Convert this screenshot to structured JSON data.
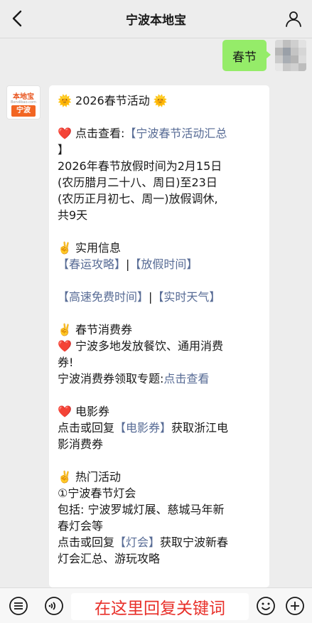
{
  "header": {
    "title": "宁波本地宝"
  },
  "outgoing": {
    "text": "春节"
  },
  "bot": {
    "logo_text": "本地宝",
    "logo_url": "Bendibao.com",
    "logo_city": "宁波"
  },
  "message": {
    "title": "2026春节活动",
    "l1_prefix": "点击查看:",
    "l1_link": "【宁波春节活动汇总",
    "l1_tail": "】",
    "l2": "2026年春节放假时间为2月15日",
    "l3": "(农历腊月二十八、周日)至23日",
    "l4": "(农历正月初七、周一)放假调休,",
    "l5": "共9天",
    "s1_title": "实用信息",
    "s1_link1": "【春运攻略】",
    "s1_sep1": "|",
    "s1_link2": "【放假时间】",
    "s1_link3": "【高速免费时间】",
    "s1_sep2": "|",
    "s1_link4": "【实时天气】",
    "s2_title": "春节消费券",
    "s2_l1": "宁波多地发放餐饮、通用消费",
    "s2_l2": "券!",
    "s2_l3": "宁波消费券领取专题:",
    "s2_l3_link": "点击查看",
    "s3_title": "电影券",
    "s3_l1_a": "点击或回复",
    "s3_l1_link": "【电影券】",
    "s3_l1_b": "获取浙江电",
    "s3_l2": "影消费券",
    "s4_title": "热门活动",
    "s4_l1": "①宁波春节灯会",
    "s4_l2": "包括: 宁波罗城灯展、慈城马年新",
    "s4_l3": "春灯会等",
    "s4_l4_a": "点击或回复",
    "s4_l4_link": "【灯会】",
    "s4_l4_b": "获取宁波新春",
    "s4_l5": "灯会汇总、游玩攻略"
  },
  "bottom": {
    "input_placeholder": "在这里回复关键词"
  },
  "colors": {
    "link": "#576b95",
    "outgoing_bubble": "#95ec69",
    "hint_text": "#e8302a",
    "heart": "#e23a3a",
    "sun": "#f5a623"
  },
  "icons": [
    "back-icon",
    "profile-icon",
    "sun-icon",
    "heart-icon",
    "victory-hand-icon",
    "menu-icon",
    "voice-icon",
    "emoji-icon",
    "plus-icon"
  ]
}
